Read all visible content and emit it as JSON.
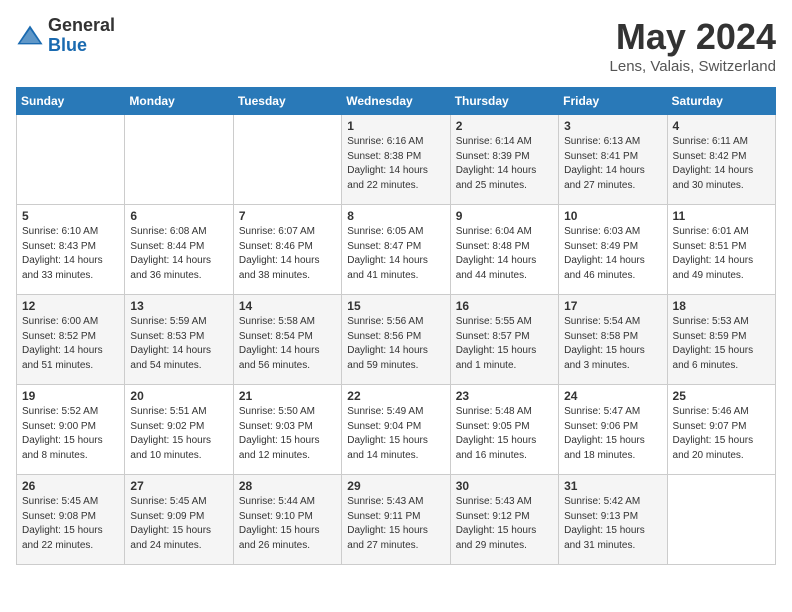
{
  "logo": {
    "general": "General",
    "blue": "Blue"
  },
  "title": "May 2024",
  "location": "Lens, Valais, Switzerland",
  "days_of_week": [
    "Sunday",
    "Monday",
    "Tuesday",
    "Wednesday",
    "Thursday",
    "Friday",
    "Saturday"
  ],
  "weeks": [
    [
      {
        "day": "",
        "info": ""
      },
      {
        "day": "",
        "info": ""
      },
      {
        "day": "",
        "info": ""
      },
      {
        "day": "1",
        "info": "Sunrise: 6:16 AM\nSunset: 8:38 PM\nDaylight: 14 hours and 22 minutes."
      },
      {
        "day": "2",
        "info": "Sunrise: 6:14 AM\nSunset: 8:39 PM\nDaylight: 14 hours and 25 minutes."
      },
      {
        "day": "3",
        "info": "Sunrise: 6:13 AM\nSunset: 8:41 PM\nDaylight: 14 hours and 27 minutes."
      },
      {
        "day": "4",
        "info": "Sunrise: 6:11 AM\nSunset: 8:42 PM\nDaylight: 14 hours and 30 minutes."
      }
    ],
    [
      {
        "day": "5",
        "info": "Sunrise: 6:10 AM\nSunset: 8:43 PM\nDaylight: 14 hours and 33 minutes."
      },
      {
        "day": "6",
        "info": "Sunrise: 6:08 AM\nSunset: 8:44 PM\nDaylight: 14 hours and 36 minutes."
      },
      {
        "day": "7",
        "info": "Sunrise: 6:07 AM\nSunset: 8:46 PM\nDaylight: 14 hours and 38 minutes."
      },
      {
        "day": "8",
        "info": "Sunrise: 6:05 AM\nSunset: 8:47 PM\nDaylight: 14 hours and 41 minutes."
      },
      {
        "day": "9",
        "info": "Sunrise: 6:04 AM\nSunset: 8:48 PM\nDaylight: 14 hours and 44 minutes."
      },
      {
        "day": "10",
        "info": "Sunrise: 6:03 AM\nSunset: 8:49 PM\nDaylight: 14 hours and 46 minutes."
      },
      {
        "day": "11",
        "info": "Sunrise: 6:01 AM\nSunset: 8:51 PM\nDaylight: 14 hours and 49 minutes."
      }
    ],
    [
      {
        "day": "12",
        "info": "Sunrise: 6:00 AM\nSunset: 8:52 PM\nDaylight: 14 hours and 51 minutes."
      },
      {
        "day": "13",
        "info": "Sunrise: 5:59 AM\nSunset: 8:53 PM\nDaylight: 14 hours and 54 minutes."
      },
      {
        "day": "14",
        "info": "Sunrise: 5:58 AM\nSunset: 8:54 PM\nDaylight: 14 hours and 56 minutes."
      },
      {
        "day": "15",
        "info": "Sunrise: 5:56 AM\nSunset: 8:56 PM\nDaylight: 14 hours and 59 minutes."
      },
      {
        "day": "16",
        "info": "Sunrise: 5:55 AM\nSunset: 8:57 PM\nDaylight: 15 hours and 1 minute."
      },
      {
        "day": "17",
        "info": "Sunrise: 5:54 AM\nSunset: 8:58 PM\nDaylight: 15 hours and 3 minutes."
      },
      {
        "day": "18",
        "info": "Sunrise: 5:53 AM\nSunset: 8:59 PM\nDaylight: 15 hours and 6 minutes."
      }
    ],
    [
      {
        "day": "19",
        "info": "Sunrise: 5:52 AM\nSunset: 9:00 PM\nDaylight: 15 hours and 8 minutes."
      },
      {
        "day": "20",
        "info": "Sunrise: 5:51 AM\nSunset: 9:02 PM\nDaylight: 15 hours and 10 minutes."
      },
      {
        "day": "21",
        "info": "Sunrise: 5:50 AM\nSunset: 9:03 PM\nDaylight: 15 hours and 12 minutes."
      },
      {
        "day": "22",
        "info": "Sunrise: 5:49 AM\nSunset: 9:04 PM\nDaylight: 15 hours and 14 minutes."
      },
      {
        "day": "23",
        "info": "Sunrise: 5:48 AM\nSunset: 9:05 PM\nDaylight: 15 hours and 16 minutes."
      },
      {
        "day": "24",
        "info": "Sunrise: 5:47 AM\nSunset: 9:06 PM\nDaylight: 15 hours and 18 minutes."
      },
      {
        "day": "25",
        "info": "Sunrise: 5:46 AM\nSunset: 9:07 PM\nDaylight: 15 hours and 20 minutes."
      }
    ],
    [
      {
        "day": "26",
        "info": "Sunrise: 5:45 AM\nSunset: 9:08 PM\nDaylight: 15 hours and 22 minutes."
      },
      {
        "day": "27",
        "info": "Sunrise: 5:45 AM\nSunset: 9:09 PM\nDaylight: 15 hours and 24 minutes."
      },
      {
        "day": "28",
        "info": "Sunrise: 5:44 AM\nSunset: 9:10 PM\nDaylight: 15 hours and 26 minutes."
      },
      {
        "day": "29",
        "info": "Sunrise: 5:43 AM\nSunset: 9:11 PM\nDaylight: 15 hours and 27 minutes."
      },
      {
        "day": "30",
        "info": "Sunrise: 5:43 AM\nSunset: 9:12 PM\nDaylight: 15 hours and 29 minutes."
      },
      {
        "day": "31",
        "info": "Sunrise: 5:42 AM\nSunset: 9:13 PM\nDaylight: 15 hours and 31 minutes."
      },
      {
        "day": "",
        "info": ""
      }
    ]
  ]
}
